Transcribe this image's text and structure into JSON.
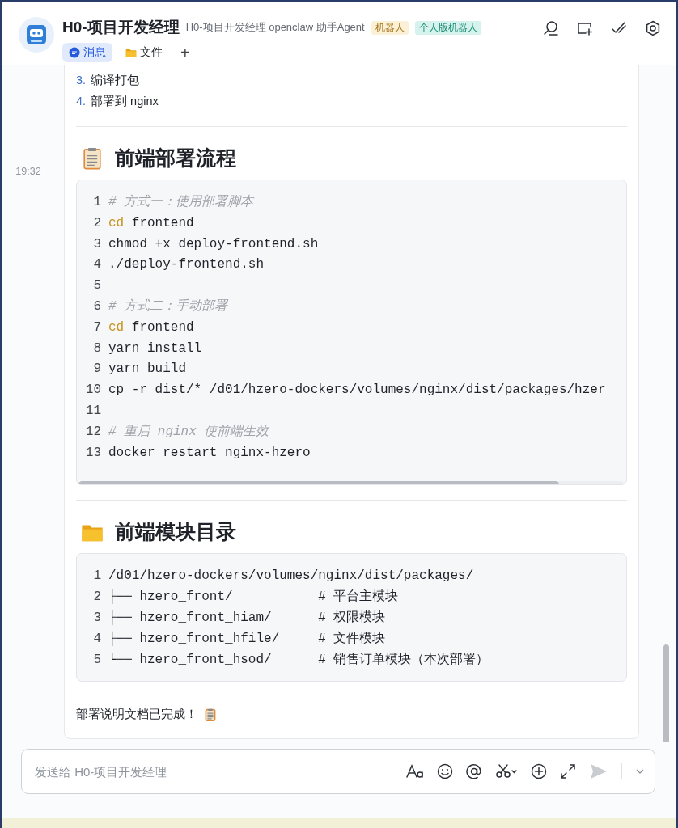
{
  "header": {
    "title": "H0-项目开发经理",
    "subtitle": "H0-项目开发经理 openclaw 助手Agent",
    "tags": [
      {
        "text": "机器人",
        "color": "#fbf1d6"
      },
      {
        "text": "个人版机器人",
        "color": "#d5f3ec"
      }
    ],
    "tabs": [
      {
        "label": "消息",
        "selected": true
      },
      {
        "label": "文件",
        "selected": false
      }
    ],
    "add_tab": "+"
  },
  "message": {
    "time": "19:32",
    "list": [
      {
        "number": "3.",
        "text": "编译打包"
      },
      {
        "number": "4.",
        "text": "部署到 nginx"
      }
    ],
    "sections": [
      {
        "heading": "前端部署流程",
        "horizontal_scroll": true,
        "lines": [
          {
            "number": "1",
            "tokens": [
              {
                "kind": "comment",
                "text": "# 方式一：使用部署脚本"
              }
            ]
          },
          {
            "number": "2",
            "tokens": [
              {
                "kind": "keyword",
                "text": "cd"
              },
              {
                "kind": "plain",
                "text": " frontend"
              }
            ]
          },
          {
            "number": "3",
            "tokens": [
              {
                "kind": "plain",
                "text": "chmod +x deploy-frontend.sh"
              }
            ]
          },
          {
            "number": "4",
            "tokens": [
              {
                "kind": "plain",
                "text": "./deploy-frontend.sh"
              }
            ]
          },
          {
            "number": "5"
          },
          {
            "number": "6",
            "tokens": [
              {
                "kind": "comment",
                "text": "# 方式二：手动部署"
              }
            ]
          },
          {
            "number": "7",
            "tokens": [
              {
                "kind": "keyword",
                "text": "cd"
              },
              {
                "kind": "plain",
                "text": " frontend"
              }
            ]
          },
          {
            "number": "8",
            "tokens": [
              {
                "kind": "plain",
                "text": "yarn install"
              }
            ]
          },
          {
            "number": "9",
            "tokens": [
              {
                "kind": "plain",
                "text": "yarn build"
              }
            ]
          },
          {
            "number": "10",
            "tokens": [
              {
                "kind": "plain",
                "text": "cp -r dist/* /d01/hzero-dockers/volumes/nginx/dist/packages/hzer"
              }
            ]
          },
          {
            "number": "11"
          },
          {
            "number": "12",
            "tokens": [
              {
                "kind": "comment",
                "text": "# 重启 nginx 使前端生效"
              }
            ]
          },
          {
            "number": "13",
            "tokens": [
              {
                "kind": "plain",
                "text": "docker restart nginx-hzero"
              }
            ]
          }
        ]
      },
      {
        "heading": "前端模块目录",
        "horizontal_scroll": false,
        "lines": [
          {
            "number": "1",
            "tokens": [
              {
                "kind": "plain",
                "text": "/d01/hzero-dockers/volumes/nginx/dist/packages/"
              }
            ]
          },
          {
            "number": "2",
            "tokens": [
              {
                "kind": "plain",
                "text": "├── hzero_front/           # 平台主模块"
              }
            ]
          },
          {
            "number": "3",
            "tokens": [
              {
                "kind": "plain",
                "text": "├── hzero_front_hiam/      # 权限模块"
              }
            ]
          },
          {
            "number": "4",
            "tokens": [
              {
                "kind": "plain",
                "text": "├── hzero_front_hfile/     # 文件模块"
              }
            ]
          },
          {
            "number": "5",
            "tokens": [
              {
                "kind": "plain",
                "text": "└── hzero_front_hsod/      # 销售订单模块（本次部署）"
              }
            ]
          }
        ]
      }
    ],
    "footer": "部署说明文档已完成！"
  },
  "composer": {
    "placeholder": "发送给 H0-项目开发经理"
  }
}
